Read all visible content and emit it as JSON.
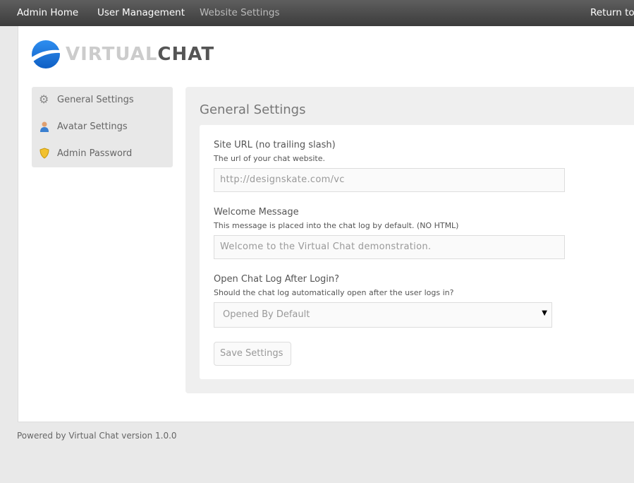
{
  "nav": {
    "items": [
      {
        "label": "Admin Home"
      },
      {
        "label": "User Management"
      },
      {
        "label": "Website Settings",
        "active": true
      }
    ],
    "return_label": "Return to site"
  },
  "logo": {
    "part1": "VIRTUAL",
    "part2": "CHAT"
  },
  "sidebar": {
    "items": [
      {
        "label": "General Settings",
        "icon": "gear-icon"
      },
      {
        "label": "Avatar Settings",
        "icon": "user-icon"
      },
      {
        "label": "Admin Password",
        "icon": "shield-icon"
      }
    ]
  },
  "main": {
    "title": "General Settings",
    "site_url": {
      "label": "Site URL (no trailing slash)",
      "help": "The url of your chat website.",
      "value": "http://designskate.com/vc"
    },
    "welcome": {
      "label": "Welcome Message",
      "help": "This message is placed into the chat log by default. (NO HTML)",
      "value": "Welcome to the Virtual Chat demonstration."
    },
    "chatlog": {
      "label": "Open Chat Log After Login?",
      "help": "Should the chat log automatically open after the user logs in?",
      "selected": "Opened By Default"
    },
    "save_label": "Save Settings"
  },
  "footer": {
    "text": "Powered by Virtual Chat version 1.0.0"
  },
  "colors": {
    "brand_blue": "#1a7ad8",
    "nav_bg": "#4a4a4a"
  }
}
